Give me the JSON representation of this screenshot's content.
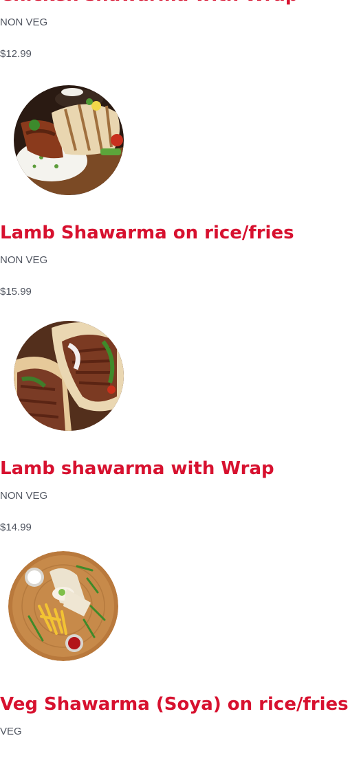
{
  "menu_items": [
    {
      "title": "Chicken shawarma with Wrap",
      "type": "NON VEG",
      "price": "$12.99",
      "image": "chicken-shawarma-wrap-photo"
    },
    {
      "title": "Lamb Shawarma on rice/fries",
      "type": "NON VEG",
      "price": "$15.99",
      "image": "lamb-shawarma-rice-photo"
    },
    {
      "title": "Lamb shawarma with Wrap",
      "type": "NON VEG",
      "price": "$14.99",
      "image": "lamb-shawarma-wrap-photo"
    },
    {
      "title": "Veg Shawarma (Soya) on rice/fries",
      "type": "VEG",
      "price": "",
      "image": ""
    }
  ],
  "colors": {
    "title": "#d7112f",
    "text": "#505560"
  }
}
